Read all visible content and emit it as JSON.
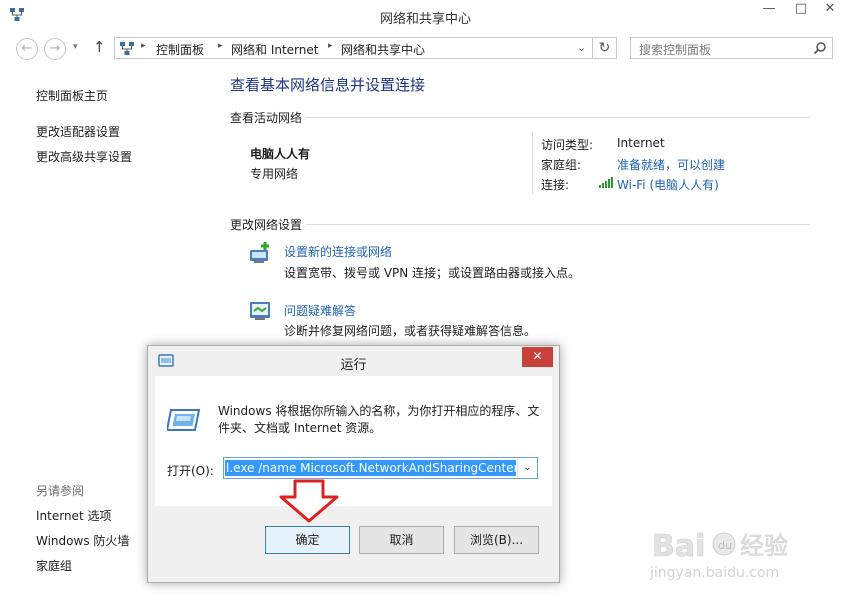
{
  "window": {
    "title": "网络和共享中心",
    "minimize": "—",
    "maximize": "□",
    "close": "✕"
  },
  "nav": {
    "back": "←",
    "forward": "→",
    "history": "▾",
    "up": "↑",
    "refresh": "↻"
  },
  "address": {
    "crumbs": [
      "控制面板",
      "网络和 Internet",
      "网络和共享中心"
    ],
    "separator": "▸",
    "dropdown": "⌄"
  },
  "search": {
    "placeholder": "搜索控制面板"
  },
  "sidebar": {
    "home": "控制面板主页",
    "items": [
      "更改适配器设置",
      "更改高级共享设置"
    ],
    "see_also_title": "另请参阅",
    "see_also": [
      "Internet 选项",
      "Windows 防火墙",
      "家庭组"
    ]
  },
  "main": {
    "heading": "查看基本网络信息并设置连接",
    "active_title": "查看活动网络",
    "network_name": "电脑人人有",
    "network_type": "专用网络",
    "access_type_label": "访问类型:",
    "access_type_value": "Internet",
    "homegroup_label": "家庭组:",
    "homegroup_value": "准备就绪，可以创建",
    "connection_label": "连接:",
    "connection_value": "Wi-Fi (电脑人人有)",
    "change_title": "更改网络设置",
    "tasks": [
      {
        "link": "设置新的连接或网络",
        "desc": "设置宽带、拨号或 VPN 连接；或设置路由器或接入点。"
      },
      {
        "link": "问题疑难解答",
        "desc": "诊断并修复网络问题，或者获得疑难解答信息。"
      }
    ]
  },
  "run_dialog": {
    "title": "运行",
    "close": "✕",
    "description": "Windows 将根据你所输入的名称，为你打开相应的程序、文件夹、文档或 Internet 资源。",
    "open_label": "打开(O):",
    "open_value": "l.exe /name Microsoft.NetworkAndSharingCenter",
    "dropdown": "⌄",
    "ok": "确定",
    "cancel": "取消",
    "browse": "浏览(B)..."
  },
  "watermark": {
    "logo": "Bai du 经验",
    "url": "jingyan.baidu.com"
  },
  "colors": {
    "link": "#1e64b4",
    "heading": "#1e3287",
    "close_red": "#c7403a",
    "selection": "#3399ff",
    "arrow_red": "#e02020"
  }
}
